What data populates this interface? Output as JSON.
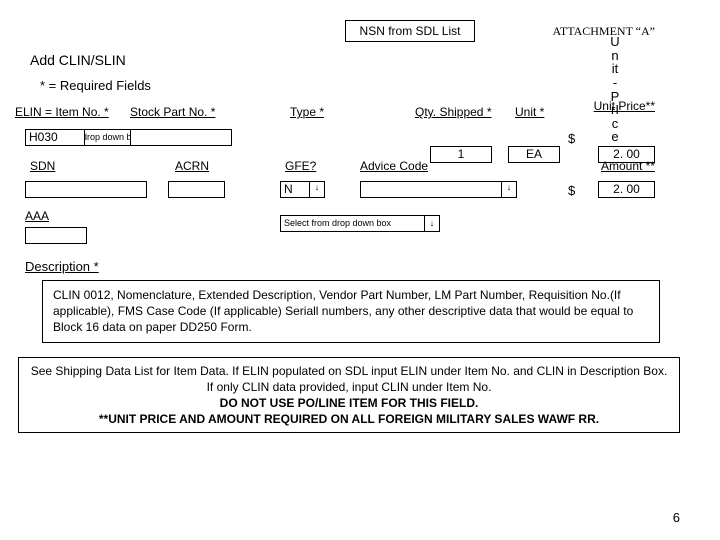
{
  "header": {
    "nsn_box": "NSN from SDL List",
    "attachment": "ATTACHMENT “A”",
    "add_clin": "Add CLIN/SLIN",
    "req_fields": "* = Required Fields"
  },
  "labels": {
    "elin": "ELIN = Item No. *",
    "stock": "Stock Part No. *",
    "type": "Type *",
    "qty": "Qty. Shipped *",
    "unit": "Unit *",
    "unit_price": "Unit Price**",
    "sdn": "SDN",
    "acrn": "ACRN",
    "gfe": "GFE?",
    "advice": "Advice Code",
    "amount": "Amount **",
    "aaa": "AAA",
    "description": "Description *"
  },
  "values": {
    "item_no": "H030",
    "type_select": "Select from drop down box",
    "qty": "1",
    "unit": "EA",
    "unit_price": "2. 00",
    "gfe": "N",
    "amount": "2. 00",
    "advice_select": "Select from drop down box",
    "dollar": "$"
  },
  "vertical_text": "Unit-PrIce",
  "description_text": "CLIN 0012, Nomenclature, Extended Description, Vendor Part Number, LM Part Number, Requisition No.(If applicable), FMS Case Code (If applicable) Seriall numbers, any other descriptive data that would be equal to Block 16 data on paper DD250 Form.",
  "instructions": {
    "line1": "See Shipping Data List for Item Data.  If ELIN populated on SDL input ELIN under Item No. and CLIN in Description Box.  If only CLIN data provided, input CLIN under Item No.",
    "line2": "DO NOT USE PO/LINE ITEM FOR THIS FIELD.",
    "line3": "**UNIT PRICE AND AMOUNT REQUIRED ON ALL FOREIGN MILITARY SALES WAWF RR."
  },
  "page_number": "6"
}
